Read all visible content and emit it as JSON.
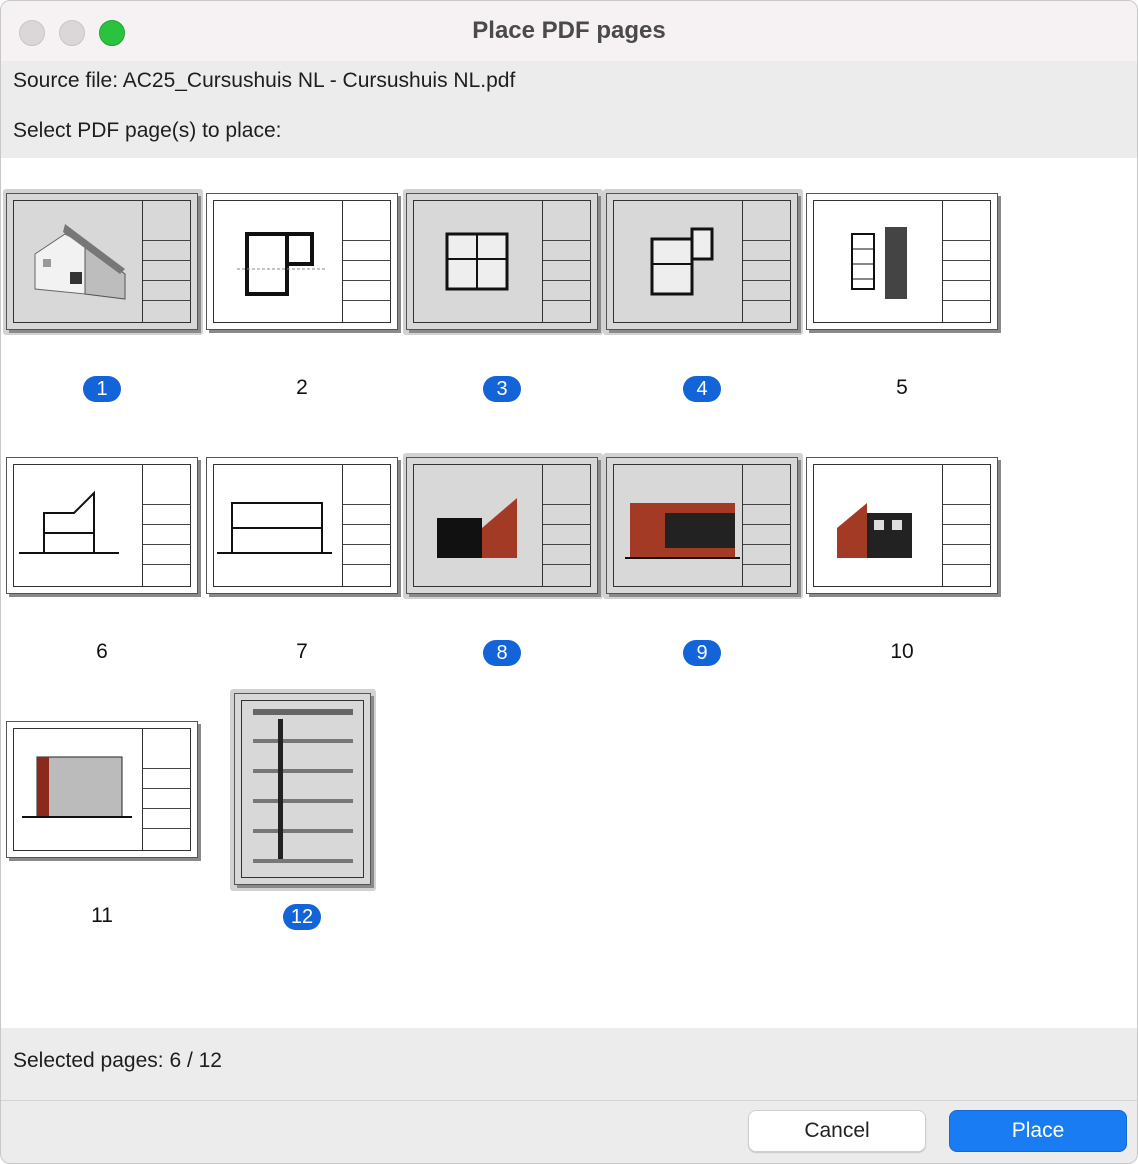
{
  "window": {
    "title": "Place PDF pages"
  },
  "source": {
    "label": "Source file: AC25_Cursushuis NL - Cursushuis NL.pdf"
  },
  "instruction": {
    "label": "Select PDF page(s) to place:"
  },
  "pages": [
    {
      "number": "1",
      "selected": true
    },
    {
      "number": "2",
      "selected": false
    },
    {
      "number": "3",
      "selected": true
    },
    {
      "number": "4",
      "selected": true
    },
    {
      "number": "5",
      "selected": false
    },
    {
      "number": "6",
      "selected": false
    },
    {
      "number": "7",
      "selected": false
    },
    {
      "number": "8",
      "selected": true
    },
    {
      "number": "9",
      "selected": true
    },
    {
      "number": "10",
      "selected": false
    },
    {
      "number": "11",
      "selected": false
    },
    {
      "number": "12",
      "selected": true
    }
  ],
  "footer": {
    "selected_text": "Selected pages: 6 / 12"
  },
  "buttons": {
    "cancel": "Cancel",
    "place": "Place"
  },
  "colors": {
    "accent": "#1a7cf2",
    "badge": "#1264d8",
    "zoom": "#2ac23e"
  }
}
